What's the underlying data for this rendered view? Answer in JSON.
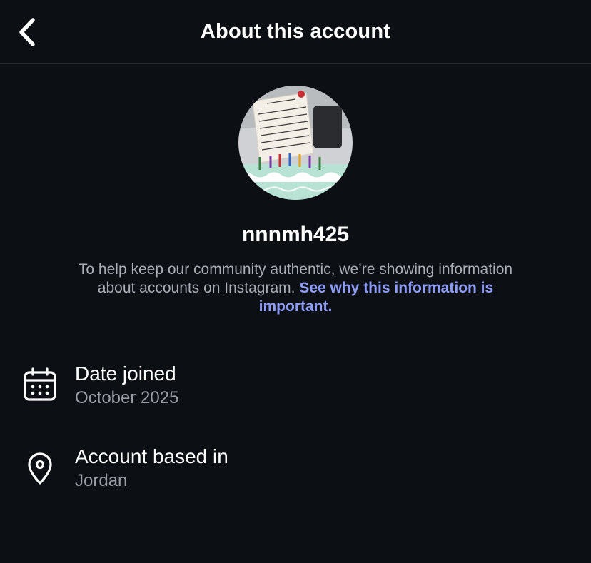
{
  "header": {
    "title": "About this account",
    "back_icon": "chevron-left-icon"
  },
  "profile": {
    "username": "nnnmh425",
    "avatar_alt": "profile picture"
  },
  "info": {
    "text": "To help keep our community authentic, we’re showing information about accounts on Instagram. ",
    "link_text": "See why this information is important."
  },
  "details": [
    {
      "icon": "calendar-icon",
      "title": "Date joined",
      "value": "October 2025"
    },
    {
      "icon": "location-pin-icon",
      "title": "Account based in",
      "value": "Jordan"
    }
  ],
  "colors": {
    "background": "#0c0f14",
    "link": "#8d9cf8",
    "secondary_text": "#9a9ea6"
  }
}
